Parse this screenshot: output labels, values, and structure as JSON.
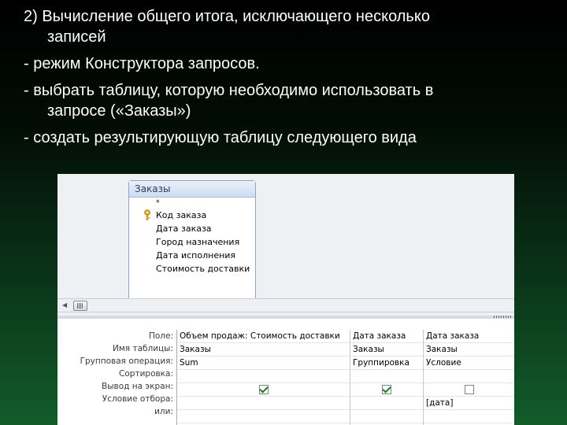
{
  "bullets": [
    {
      "line1": "2) Вычисление общего итога, исключающего несколько",
      "line2": "записей"
    },
    {
      "line1": "- режим Конструктора запросов.",
      "line2": ""
    },
    {
      "line1": "- выбрать  таблицу, которую необходимо использовать в",
      "line2": "запросе («Заказы»)"
    },
    {
      "line1": "- создать результирующую таблицу следующего вида",
      "line2": ""
    }
  ],
  "table_box": {
    "title": "Заказы",
    "star": "*",
    "fields": [
      "Код заказа",
      "Дата заказа",
      "Город назначения",
      "Дата исполнения",
      "Стоимость доставки"
    ]
  },
  "grid": {
    "row_labels": [
      "Поле:",
      "Имя таблицы:",
      "Групповая операция:",
      "Сортировка:",
      "Вывод на экран:",
      "Условие отбора:",
      "или:"
    ],
    "columns": [
      {
        "field": "Объем продаж: Стоимость доставки",
        "table": "Заказы",
        "group_op": "Sum",
        "sort": "",
        "show": true,
        "criteria": "",
        "or": ""
      },
      {
        "field": "Дата заказа",
        "table": "Заказы",
        "group_op": "Группировка",
        "sort": "",
        "show": true,
        "criteria": "",
        "or": ""
      },
      {
        "field": "Дата заказа",
        "table": "Заказы",
        "group_op": "Условие",
        "sort": "",
        "show": false,
        "criteria": "[дата]",
        "or": ""
      }
    ]
  },
  "colors": {
    "key_icon": "#e3b21a",
    "check": "#1f7a1f",
    "title_text": "#2b3d5c"
  }
}
